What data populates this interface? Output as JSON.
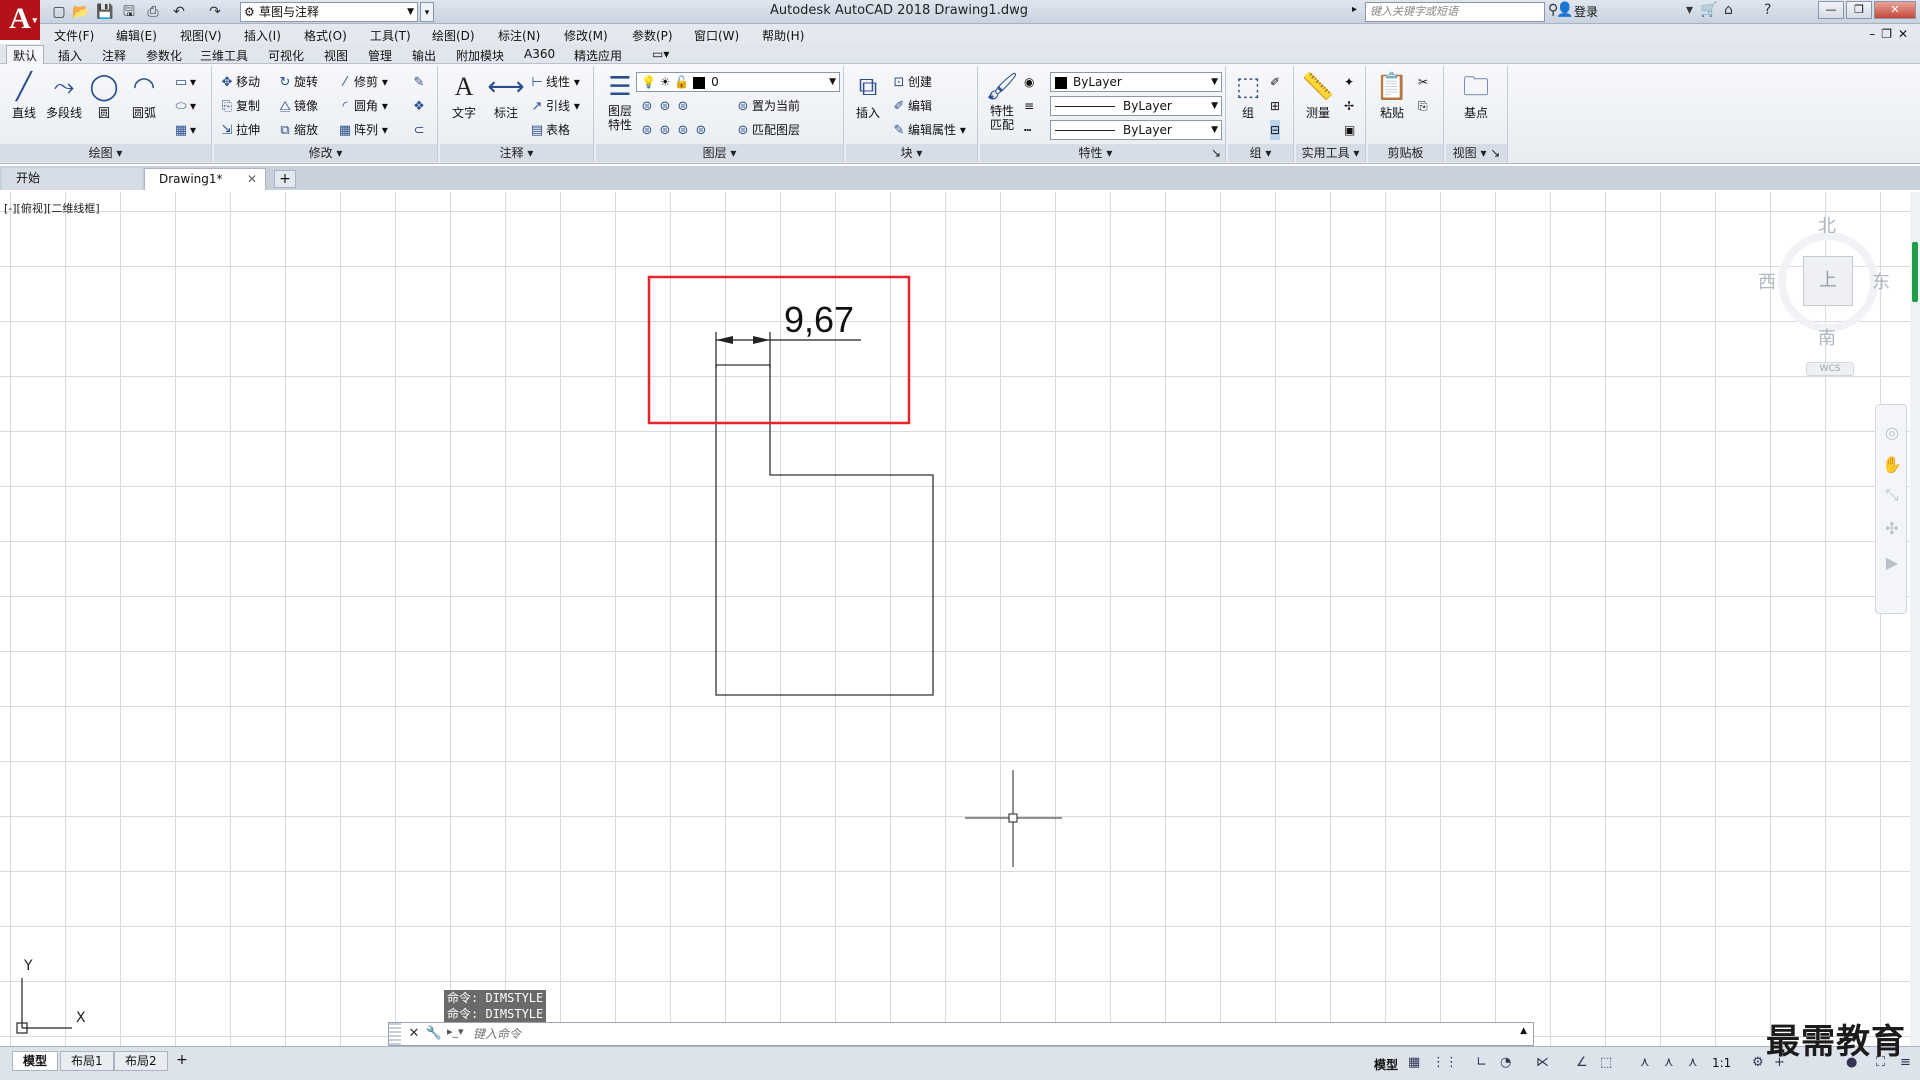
{
  "titlebar": {
    "workspace": "草图与注释",
    "title": "Autodesk AutoCAD 2018    Drawing1.dwg",
    "search_placeholder": "键入关键字或短语",
    "login": "登录"
  },
  "menu": [
    "文件(F)",
    "编辑(E)",
    "视图(V)",
    "插入(I)",
    "格式(O)",
    "工具(T)",
    "绘图(D)",
    "标注(N)",
    "修改(M)",
    "参数(P)",
    "窗口(W)",
    "帮助(H)"
  ],
  "ribbon_tabs": [
    "默认",
    "插入",
    "注释",
    "参数化",
    "三维工具",
    "可视化",
    "视图",
    "管理",
    "输出",
    "附加模块",
    "A360",
    "精选应用"
  ],
  "ribbon": {
    "draw": {
      "title": "绘图",
      "line": "直线",
      "polyline": "多段线",
      "circle": "圆",
      "arc": "圆弧"
    },
    "modify": {
      "title": "修改",
      "move": "移动",
      "rotate": "旋转",
      "trim": "修剪",
      "copy": "复制",
      "mirror": "镜像",
      "fillet": "圆角",
      "stretch": "拉伸",
      "scale": "缩放",
      "array": "阵列"
    },
    "annotation": {
      "title": "注释",
      "text": "文字",
      "dimension": "标注",
      "linear": "线性",
      "leader": "引线",
      "table": "表格"
    },
    "layers": {
      "title": "图层",
      "properties": "图层\n特性",
      "layer_name": "0",
      "set_current": "置为当前",
      "match_layer": "匹配图层"
    },
    "block": {
      "title": "块",
      "insert": "插入",
      "create": "创建",
      "edit": "编辑",
      "edit_attr": "编辑属性"
    },
    "properties": {
      "title": "特性",
      "match": "特性\n匹配",
      "color": "ByLayer",
      "linetype": "ByLayer",
      "lineweight": "ByLayer"
    },
    "groups": {
      "title": "组",
      "group": "组"
    },
    "utilities": {
      "title": "实用工具",
      "measure": "测量"
    },
    "clipboard": {
      "title": "剪贴板",
      "paste": "粘贴"
    },
    "view": {
      "title": "视图",
      "base": "基点"
    }
  },
  "filetabs": {
    "start": "开始",
    "drawing": "Drawing1*"
  },
  "canvas": {
    "view_label": "[-][俯视][二维线框]",
    "dimension_text": "9,67",
    "viewcube": {
      "north": "北",
      "south": "南",
      "east": "东",
      "west": "西",
      "top": "上",
      "wcs": "WCS"
    },
    "ucs_x": "X",
    "ucs_y": "Y"
  },
  "command": {
    "history": [
      "命令: DIMSTYLE",
      "命令: DIMSTYLE"
    ],
    "placeholder": "键入命令"
  },
  "layout_tabs": [
    "模型",
    "布局1",
    "布局2"
  ],
  "status": {
    "model": "模型",
    "scale": "1:1"
  },
  "watermark": "最需教育",
  "colors": {
    "highlight": "#e8232a",
    "accent": "#1f9e4a",
    "logo": "#b3121a"
  }
}
